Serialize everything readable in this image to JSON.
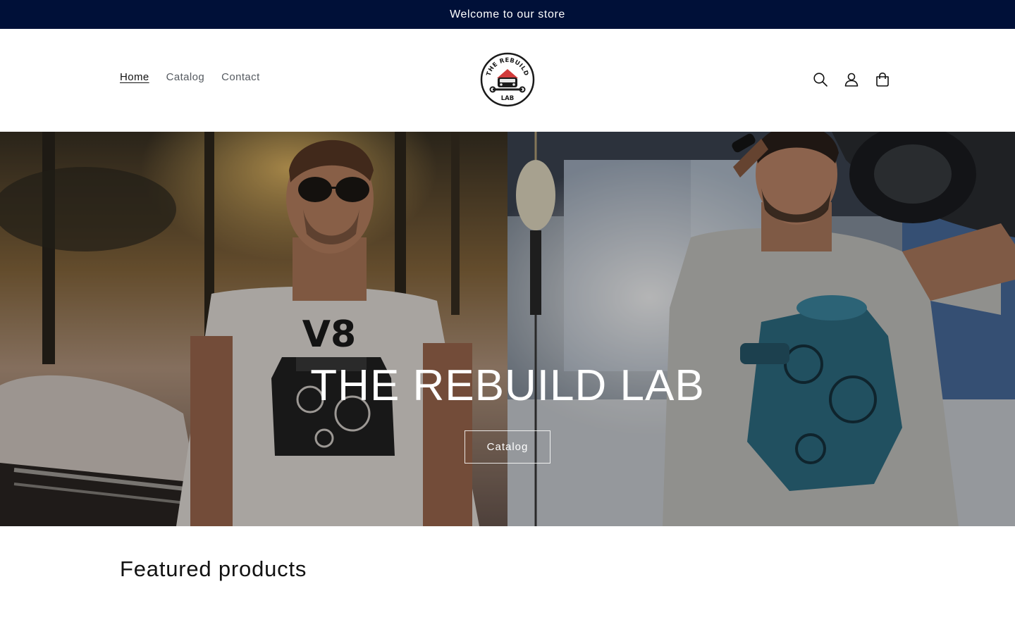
{
  "announcement": {
    "text": "Welcome to our store"
  },
  "nav": {
    "items": [
      {
        "label": "Home"
      },
      {
        "label": "Catalog"
      },
      {
        "label": "Contact"
      }
    ]
  },
  "logo": {
    "top_text": "THE REBUILD",
    "bottom_text": "LAB"
  },
  "header_icons": [
    "search-icon",
    "account-icon",
    "cart-icon"
  ],
  "hero": {
    "title": "THE REBUILD LAB",
    "button_label": "Catalog",
    "left_shirt_text": "V8"
  },
  "featured": {
    "title": "Featured products"
  },
  "colors": {
    "announcement_bg": "#001038",
    "logo_roof": "#d23b3b",
    "text": "#121212"
  }
}
